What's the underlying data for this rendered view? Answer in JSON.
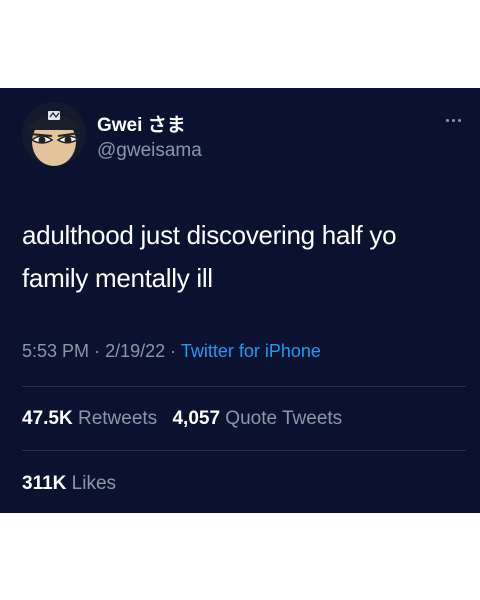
{
  "tweet": {
    "author": {
      "display_name": "Gwei さま",
      "handle": "@gweisama",
      "avatar_icon": "anime-avatar-icon"
    },
    "more_icon": "more-options-icon",
    "text": "adulthood just discovering half yo family mentally ill",
    "time": "5:53 PM",
    "date": "2/19/22",
    "separator": "·",
    "source": "Twitter for iPhone",
    "retweets_count": "47.5K",
    "retweets_label": "Retweets",
    "quote_count": "4,057",
    "quote_label": "Quote Tweets",
    "likes_count": "311K",
    "likes_label": "Likes"
  },
  "colors": {
    "background": "#0b1230",
    "text": "#ffffff",
    "secondary": "#8b97a6",
    "link": "#1d9bf0"
  }
}
